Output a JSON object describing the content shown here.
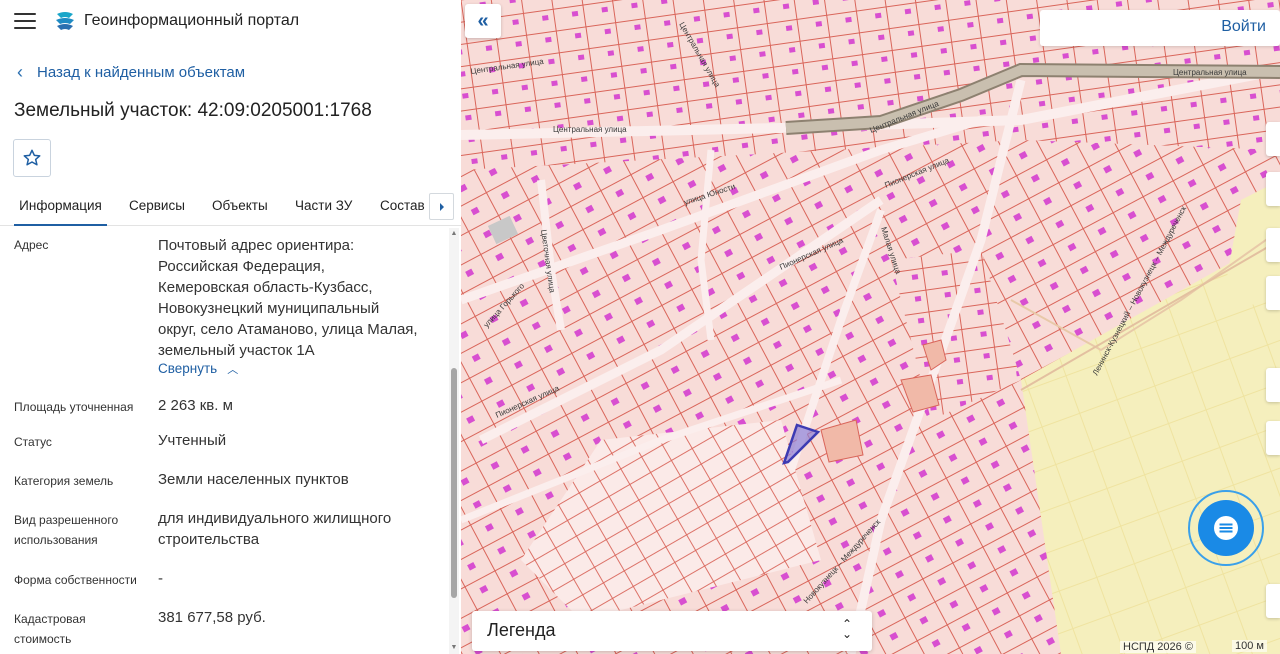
{
  "app": {
    "title": "Геоинформационный портал"
  },
  "nav": {
    "back_label": "Назад к найденным объектам"
  },
  "object": {
    "title": "Земельный участок: 42:09:0205001:1768"
  },
  "tabs": [
    {
      "label": "Информация"
    },
    {
      "label": "Сервисы"
    },
    {
      "label": "Объекты"
    },
    {
      "label": "Части ЗУ"
    },
    {
      "label": "Состав"
    }
  ],
  "info": {
    "address_label": "Адрес",
    "address_lines": [
      "Почтовый адрес ориентира:",
      "Российская Федерация,",
      "Кемеровская область-Кузбасс,",
      "Новокузнецкий муниципальный",
      "округ, село Атаманово, улица Малая,",
      "земельный участок 1А"
    ],
    "collapse_label": "Свернуть",
    "area_label": "Площадь уточненная",
    "area_value": "2 263 кв. м",
    "status_label": "Статус",
    "status_value": "Учтенный",
    "category_label": "Категория земель",
    "category_value": "Земли населенных пунктов",
    "use_label_1": "Вид разрешенного",
    "use_label_2": "использования",
    "use_value_1": "для индивидуального жилищного",
    "use_value_2": "строительства",
    "ownership_label": "Форма собственности",
    "ownership_value": "-",
    "cost_label_1": "Кадастровая",
    "cost_label_2": "стоимость",
    "cost_value": "381 677,58 руб."
  },
  "map": {
    "login_label": "Войти",
    "legend_label": "Легенда",
    "attribution": "НСПД 2026 ©",
    "scale_label": "100 м",
    "streets": [
      "Центральная улица",
      "Центральная улица",
      "Центральная улица",
      "Центральная улица",
      "Центральная улица",
      "улица Юности",
      "Пионерская улица",
      "Пионерская улица",
      "Пионерская улица",
      "улица Горького",
      "Малая улица",
      "Ленинск-Кузнецкий – Новокузнецк – Междуреченск",
      "Новокузнецк – Междуреченск",
      "Цветочная улица"
    ],
    "colors": {
      "background": "#f7d9d6",
      "parcel_stroke": "#d9655a",
      "building": "#d84fd0",
      "selected": "#3d3bb3",
      "road": "#b8aa98",
      "zone_yellow": "#f5efbd",
      "accent": "#1f5fa3"
    }
  },
  "icons": {
    "menu": "hamburger-icon",
    "logo": "portal-logo",
    "back": "chevron-left-icon",
    "favorite": "star-icon",
    "tab_next": "chevron-right-icon",
    "collapse_up": "chevron-up-icon",
    "collapse_panel": "double-chevron-left-icon",
    "legend_toggle": "updown-chevron-icon",
    "chat": "chat-icon"
  }
}
